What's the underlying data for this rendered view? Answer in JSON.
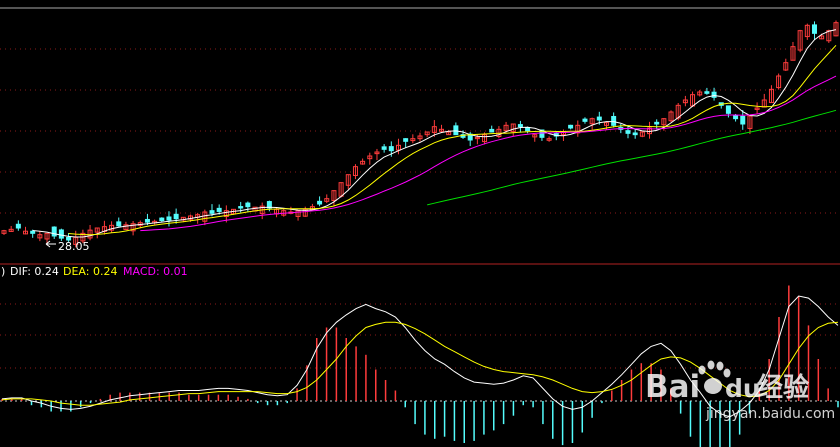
{
  "colors": {
    "background": "#000000",
    "up_candle": "#ff3c3c",
    "down_candle": "#54fcfc",
    "ma5": "#ffffff",
    "ma10": "#ffff00",
    "ma20": "#ff00ff",
    "ma60": "#00e000",
    "grid": "#8b1a1a",
    "divider": "#b22222",
    "macd_pos": "#ff3c3c",
    "macd_neg": "#54fcfc",
    "dif": "#ffffff",
    "dea": "#ffff00"
  },
  "chart_data": [
    {
      "type": "candlestick",
      "title": "",
      "annotations": [
        {
          "text": "28.05",
          "x": 22,
          "icon": "arrow-left-icon"
        }
      ],
      "close": [
        28.4,
        28.45,
        28.5,
        28.38,
        28.3,
        28.25,
        28.3,
        28.2,
        28.12,
        28.05,
        28.15,
        28.3,
        28.42,
        28.5,
        28.55,
        28.6,
        28.58,
        28.62,
        28.66,
        28.7,
        28.72,
        28.75,
        28.78,
        28.8,
        28.85,
        28.9,
        28.95,
        29.0,
        29.1,
        29.05,
        29.12,
        29.15,
        29.2,
        29.25,
        29.3,
        29.28,
        29.32,
        29.25,
        29.2,
        29.15,
        29.1,
        29.15,
        29.2,
        29.3,
        29.4,
        29.6,
        29.9,
        30.2,
        30.5,
        30.8,
        31.0,
        31.2,
        31.35,
        31.45,
        31.4,
        31.6,
        31.75,
        31.85,
        31.95,
        32.1,
        32.3,
        32.2,
        32.1,
        32.0,
        31.9,
        31.8,
        31.9,
        32.0,
        32.1,
        32.2,
        32.35,
        32.4,
        32.3,
        32.15,
        32.0,
        31.9,
        31.85,
        31.95,
        32.1,
        32.25,
        32.35,
        32.5,
        32.6,
        32.55,
        32.45,
        32.35,
        32.2,
        32.05,
        32.0,
        32.1,
        32.25,
        32.4,
        32.6,
        32.85,
        33.1,
        33.3,
        33.5,
        33.6,
        33.55,
        33.4,
        33.1,
        32.8,
        32.6,
        32.4,
        32.7,
        33.0,
        33.3,
        33.7,
        34.2,
        34.7,
        35.3,
        35.9,
        36.1,
        35.8,
        35.7,
        35.9,
        36.2
      ],
      "ma_lines": [
        "MA5",
        "MA10",
        "MA20",
        "MA60"
      ]
    },
    {
      "type": "bar+line",
      "title": "",
      "legend": [
        {
          "label": "DIF: 0.24",
          "color": "#ffffff"
        },
        {
          "label": "DEA: 0.24",
          "color": "#ffff00"
        },
        {
          "label": "MACD: 0.01",
          "color": "#ff00ff"
        }
      ],
      "legend_prefix": ")",
      "dif": [
        0.02,
        0.03,
        0.03,
        0.0,
        -0.02,
        -0.05,
        -0.07,
        -0.08,
        -0.07,
        -0.05,
        -0.02,
        0.01,
        0.03,
        0.05,
        0.06,
        0.07,
        0.08,
        0.09,
        0.1,
        0.1,
        0.1,
        0.11,
        0.12,
        0.12,
        0.11,
        0.1,
        0.08,
        0.06,
        0.05,
        0.06,
        0.15,
        0.3,
        0.5,
        0.65,
        0.75,
        0.82,
        0.88,
        0.92,
        0.88,
        0.85,
        0.8,
        0.7,
        0.58,
        0.48,
        0.4,
        0.35,
        0.28,
        0.22,
        0.18,
        0.17,
        0.16,
        0.17,
        0.2,
        0.24,
        0.22,
        0.12,
        0.02,
        -0.05,
        -0.08,
        -0.06,
        0.0,
        0.08,
        0.16,
        0.25,
        0.35,
        0.45,
        0.52,
        0.55,
        0.48,
        0.35,
        0.2,
        0.08,
        -0.05,
        -0.12,
        -0.15,
        -0.1,
        -0.02,
        0.1,
        0.3,
        0.6,
        0.9,
        1.0,
        0.98,
        0.9,
        0.8,
        0.72
      ],
      "dea": [
        0.01,
        0.02,
        0.02,
        0.02,
        0.01,
        0.0,
        -0.02,
        -0.03,
        -0.04,
        -0.04,
        -0.03,
        -0.02,
        -0.01,
        0.01,
        0.02,
        0.03,
        0.04,
        0.05,
        0.06,
        0.07,
        0.07,
        0.08,
        0.09,
        0.09,
        0.09,
        0.09,
        0.09,
        0.08,
        0.07,
        0.07,
        0.09,
        0.13,
        0.2,
        0.3,
        0.4,
        0.52,
        0.62,
        0.7,
        0.73,
        0.75,
        0.75,
        0.73,
        0.69,
        0.64,
        0.58,
        0.52,
        0.47,
        0.42,
        0.37,
        0.33,
        0.3,
        0.28,
        0.27,
        0.26,
        0.25,
        0.23,
        0.2,
        0.16,
        0.12,
        0.09,
        0.08,
        0.09,
        0.11,
        0.15,
        0.2,
        0.27,
        0.34,
        0.4,
        0.42,
        0.41,
        0.37,
        0.31,
        0.24,
        0.17,
        0.1,
        0.06,
        0.04,
        0.05,
        0.1,
        0.2,
        0.35,
        0.5,
        0.62,
        0.7,
        0.74,
        0.75
      ]
    }
  ],
  "watermark": {
    "brand": "Bai",
    "brand_suffix": "du",
    "product": "经验",
    "url": "jingyan.baidu.com"
  }
}
